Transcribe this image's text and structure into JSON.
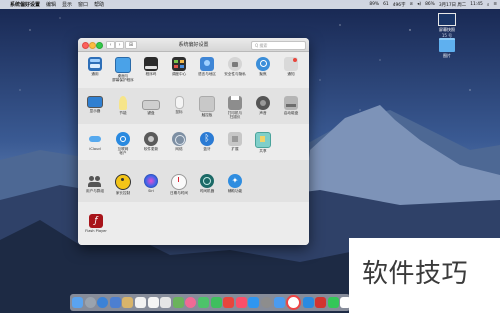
{
  "menubar": {
    "app_name": "系统偏好设置",
    "menus": [
      "编辑",
      "显示",
      "窗口",
      "帮助"
    ],
    "status": [
      "89%",
      "61",
      "496字",
      "86%",
      "3月17日 周二",
      "11:45"
    ]
  },
  "desktop": {
    "icons": [
      {
        "label": "屏幕快照",
        "sublabel": "15 号"
      },
      {
        "label": "图片"
      }
    ]
  },
  "window": {
    "title": "系统偏好设置",
    "grid_label": "⊞",
    "search_placeholder": "Q 搜索",
    "row1": [
      {
        "label": "通用",
        "icon": "general-icon"
      },
      {
        "label": "桌面与",
        "label2": "屏幕保护程序",
        "icon": "desktop-icon"
      },
      {
        "label": "程序坞",
        "icon": "dock-icon"
      },
      {
        "label": "调度中心",
        "icon": "mission-control-icon"
      },
      {
        "label": "语言与地区",
        "icon": "language-icon"
      },
      {
        "label": "安全性与隐私",
        "icon": "security-icon"
      },
      {
        "label": "聚焦",
        "icon": "spotlight-icon"
      },
      {
        "label": "通知",
        "icon": "notifications-icon"
      }
    ],
    "row2": [
      {
        "label": "显示器",
        "icon": "display-icon"
      },
      {
        "label": "节能",
        "icon": "energy-icon"
      },
      {
        "label": "键盘",
        "icon": "keyboard-icon"
      },
      {
        "label": "鼠标",
        "icon": "mouse-icon"
      },
      {
        "label": "触控板",
        "icon": "trackpad-icon"
      },
      {
        "label": "打印机与",
        "label2": "扫描仪",
        "icon": "printer-icon"
      },
      {
        "label": "声音",
        "icon": "sound-icon"
      },
      {
        "label": "启动磁盘",
        "icon": "startup-disk-icon"
      }
    ],
    "row3": [
      {
        "label": "iCloud",
        "icon": "icloud-icon"
      },
      {
        "label": "互联网",
        "label2": "帐户",
        "icon": "internet-accounts-icon"
      },
      {
        "label": "软件更新",
        "icon": "software-update-icon"
      },
      {
        "label": "网络",
        "icon": "network-icon"
      },
      {
        "label": "蓝牙",
        "icon": "bluetooth-icon"
      },
      {
        "label": "扩展",
        "icon": "extensions-icon"
      },
      {
        "label": "共享",
        "icon": "sharing-icon"
      }
    ],
    "row4": [
      {
        "label": "用户与群组",
        "icon": "users-icon"
      },
      {
        "label": "家长控制",
        "icon": "parental-controls-icon"
      },
      {
        "label": "Siri",
        "icon": "siri-icon"
      },
      {
        "label": "日期与时间",
        "icon": "date-time-icon"
      },
      {
        "label": "时间机器",
        "icon": "time-machine-icon"
      },
      {
        "label": "辅助功能",
        "icon": "accessibility-icon"
      }
    ],
    "row5": [
      {
        "label": "Flash Player",
        "icon": "flash-player-icon"
      }
    ]
  },
  "watermark": {
    "text": "软件技巧"
  }
}
